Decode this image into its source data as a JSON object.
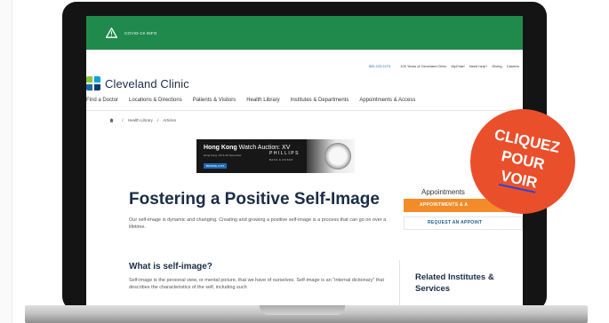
{
  "covid": {
    "label": "COVID-19 INFO"
  },
  "utility": {
    "phone": "800.223.2273",
    "items": [
      "100 Years of Cleveland Clinic",
      "MyChart",
      "Need help?",
      "Giving",
      "Careers"
    ]
  },
  "brand": {
    "name": "Cleveland Clinic",
    "colors": [
      "#8dc63f",
      "#00a3d9",
      "#1d6aa5",
      "#0c3c6b"
    ]
  },
  "nav": {
    "items": [
      "Find a Doctor",
      "Locations & Directions",
      "Patients & Visitors",
      "Health Library",
      "Institutes & Departments",
      "Appointments & Access"
    ]
  },
  "breadcrumb": {
    "home_icon": "home-icon",
    "items": [
      "Health Library",
      "Articles"
    ],
    "separator": "/"
  },
  "ad": {
    "title_bold": "Hong Kong",
    "title_rest": " Watch Auction: XV",
    "subtitle": "Hong Kong / 25 & 26 November",
    "button": "BROWSE LOTS",
    "brand": "PHILLIPS",
    "brand_sub": "BACS & RUSSO"
  },
  "article": {
    "title": "Fostering a Positive Self-Image",
    "intro": "Our self-image is dynamic and changing. Creating and growing a positive self-image is a process that can go on over a lifetime.",
    "section_title": "What is self-image?",
    "section_body": "Self-image is the personal view, or mental picture, that we have of ourselves. Self-image is an \"internal dictionary\" that describes the characteristics of the self, including such"
  },
  "sidebar": {
    "appointments_title": "Appointments",
    "appointments_button": "APPOINTMENTS & A",
    "request_button": "REQUEST AN APPOINT",
    "related_title_line1": "Related Institutes &",
    "related_title_line2": "Services"
  },
  "cta": {
    "line1": "CLIQUEZ",
    "line2": "POUR",
    "line3": "VOIR",
    "color": "#ea4f2c"
  }
}
